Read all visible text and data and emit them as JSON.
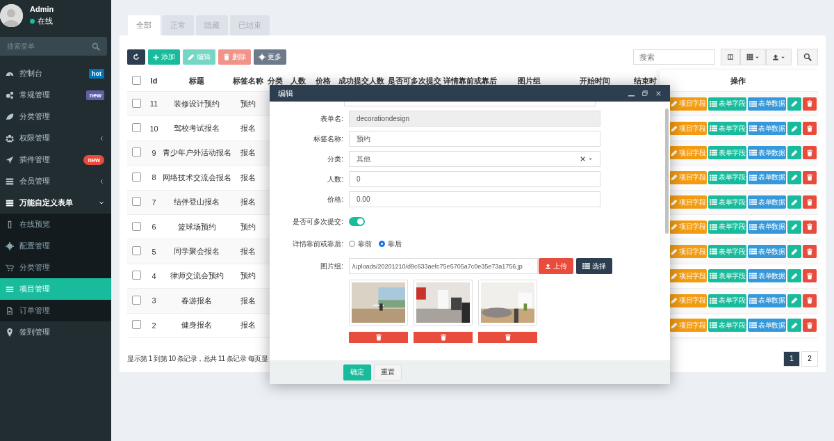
{
  "sidebar": {
    "user": {
      "name": "Admin",
      "status": "在线"
    },
    "search": {
      "placeholder": "搜索菜单"
    },
    "menu": [
      {
        "label": "控制台",
        "badge": {
          "text": "hot",
          "color": "#0073b7",
          "kind": "square"
        }
      },
      {
        "label": "常规管理",
        "badge": {
          "text": "new",
          "color": "#605ca8",
          "kind": "square"
        }
      },
      {
        "label": "分类管理"
      },
      {
        "label": "权限管理",
        "expanded": false
      },
      {
        "label": "插件管理",
        "badge": {
          "text": "new",
          "color": "#e74c3c",
          "kind": "pill"
        }
      },
      {
        "label": "会员管理",
        "expanded": false
      },
      {
        "label": "万能自定义表单",
        "expanded": true,
        "children": [
          {
            "label": "在线预览",
            "selected": false
          },
          {
            "label": "配置管理",
            "selected": false
          },
          {
            "label": "分类管理",
            "selected": false
          },
          {
            "label": "项目管理",
            "selected": true
          },
          {
            "label": "订单管理",
            "selected": false
          }
        ]
      },
      {
        "label": "签到管理"
      }
    ]
  },
  "tabs": [
    {
      "label": "全部",
      "selected": true
    },
    {
      "label": "正常",
      "selected": false
    },
    {
      "label": "隐藏",
      "selected": false
    },
    {
      "label": "已结束",
      "selected": false
    }
  ],
  "toolbar": {
    "buttons": [
      {
        "kind": "refresh",
        "disabled": false
      },
      {
        "kind": "add",
        "label": "添加",
        "disabled": false
      },
      {
        "kind": "edit",
        "label": "编辑",
        "disabled": true
      },
      {
        "kind": "delete",
        "label": "删除",
        "disabled": true
      },
      {
        "kind": "more",
        "label": "更多",
        "disabled": false
      }
    ],
    "search": {
      "placeholder": "搜索"
    }
  },
  "table": {
    "columns": [
      "Id",
      "标题",
      "标签名称",
      "分类",
      "人数",
      "价格",
      "成功提交人数",
      "是否可多次提交",
      "详情靠前或靠后",
      "图片组",
      "开始时间",
      "结束时",
      "操作"
    ],
    "header_checked": false,
    "rows": [
      {
        "checked": false,
        "id": "11",
        "title": "装修设计预约",
        "tag": "预约",
        "actions": [
          "项目字段",
          "表单字段",
          "表单数据"
        ]
      },
      {
        "checked": false,
        "id": "10",
        "title": "驾校考试报名",
        "tag": "报名",
        "actions": [
          "项目字段",
          "表单字段",
          "表单数据"
        ]
      },
      {
        "checked": false,
        "id": "9",
        "title": "青少年户外活动报名",
        "tag": "报名",
        "actions": [
          "项目字段",
          "表单字段",
          "表单数据"
        ]
      },
      {
        "checked": false,
        "id": "8",
        "title": "网络技术交流会报名",
        "tag": "报名",
        "actions": [
          "项目字段",
          "表单字段",
          "表单数据"
        ]
      },
      {
        "checked": false,
        "id": "7",
        "title": "结伴登山报名",
        "tag": "报名",
        "actions": [
          "项目字段",
          "表单字段",
          "表单数据"
        ]
      },
      {
        "checked": false,
        "id": "6",
        "title": "篮球场预约",
        "tag": "预约",
        "actions": [
          "项目字段",
          "表单字段",
          "表单数据"
        ]
      },
      {
        "checked": false,
        "id": "5",
        "title": "同学聚会报名",
        "tag": "报名",
        "actions": [
          "项目字段",
          "表单字段",
          "表单数据"
        ]
      },
      {
        "checked": false,
        "id": "4",
        "title": "律师交流会预约",
        "tag": "预约",
        "actions": [
          "项目字段",
          "表单字段",
          "表单数据"
        ]
      },
      {
        "checked": false,
        "id": "3",
        "title": "春游报名",
        "tag": "报名",
        "actions": [
          "项目字段",
          "表单字段",
          "表单数据"
        ]
      },
      {
        "checked": false,
        "id": "2",
        "title": "健身报名",
        "tag": "报名",
        "actions": [
          "项目字段",
          "表单字段",
          "表单数据"
        ]
      }
    ],
    "summary": "显示第 1 到第 10 条记录，总共 11 条记录 每页显",
    "pagination": [
      {
        "label": "1",
        "selected": true
      },
      {
        "label": "2",
        "selected": false
      }
    ]
  },
  "modal": {
    "title": "编辑",
    "fields": [
      {
        "kind": "text",
        "label": "表单名:",
        "value": "decorationdesign",
        "disabled": true
      },
      {
        "kind": "text",
        "label": "标签名称:",
        "value": "预约",
        "disabled": false
      },
      {
        "kind": "select",
        "label": "分类:",
        "value": "其他"
      },
      {
        "kind": "text",
        "label": "人数:",
        "value": "0",
        "disabled": false
      },
      {
        "kind": "text",
        "label": "价格:",
        "value": "0.00",
        "disabled": false
      },
      {
        "kind": "toggle",
        "label": "是否可多次提交:",
        "on": true
      },
      {
        "kind": "radio",
        "label": "详情靠前或靠后:",
        "options": [
          {
            "label": "靠前",
            "selected": false
          },
          {
            "label": "靠后",
            "selected": true
          }
        ]
      },
      {
        "kind": "images",
        "label": "图片组:",
        "value": "/uploads/20201210/d9c633aefc75e5705a7c0e35e73a1756.jp",
        "upload": "上传",
        "choose": "选择"
      }
    ],
    "buttons": [
      {
        "kind": "primary",
        "label": "确定"
      },
      {
        "kind": "default",
        "label": "重置"
      }
    ]
  }
}
